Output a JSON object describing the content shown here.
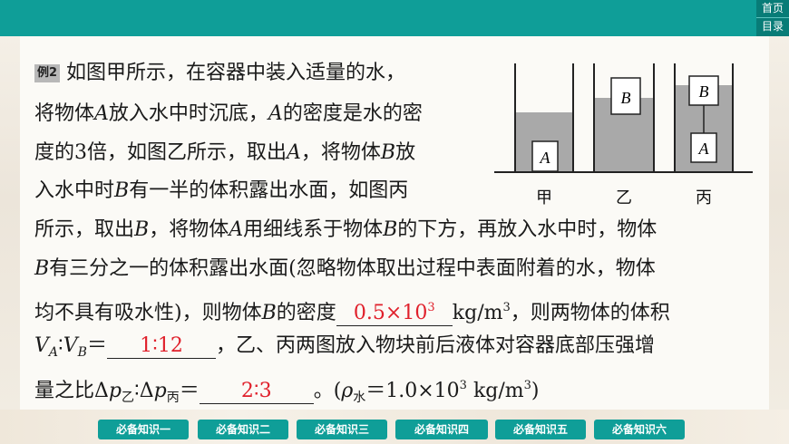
{
  "nav": {
    "home": "首页",
    "contents": "目录"
  },
  "example_tag": "例2",
  "problem": {
    "l1": "如图甲所示，在容器中装入适量的水，",
    "l2_a": "将物体",
    "l2_b": "A",
    "l2_c": "放入水中时沉底，",
    "l2_d": "A",
    "l2_e": "的密度是水的密",
    "l3_a": "度的3倍，如图乙所示，取出",
    "l3_b": "A",
    "l3_c": "，将物体",
    "l3_d": "B",
    "l3_e": "放",
    "l4_a": "入水中时",
    "l4_b": "B",
    "l4_c": "有一半的体积露出水面，如图丙",
    "l5_a": "所示，取出",
    "l5_b": "B",
    "l5_c": "，将物体",
    "l5_d": "A",
    "l5_e": "用细线系于物体",
    "l5_f": "B",
    "l5_g": "的下方，再放入水中时，物体",
    "l6_a": "B",
    "l6_b": "有三分之一的体积露出水面(忽略物体取出过程中表面附着的水，物体",
    "l7_a": "均不具有吸水性)，则物体",
    "l7_b": "B",
    "l7_c": "的密度",
    "l7_d": "kg/m",
    "l7_e": "3",
    "l7_f": "，则两物体的体积",
    "l8_a": "V",
    "l8_b": "A",
    "l8_c": "∶",
    "l8_d": "V",
    "l8_e": "B",
    "l8_f": "＝",
    "l8_g": "，乙、丙两图放入物块前后液体对容器底部压强增",
    "l9_a": "量之比Δ",
    "l9_b": "p",
    "l9_c": "乙",
    "l9_d": "∶Δ",
    "l9_e": "p",
    "l9_f": "丙",
    "l9_g": "＝",
    "l9_h": "。(",
    "l9_i": "ρ",
    "l9_j": "水",
    "l9_k": "＝1.0×10",
    "l9_l": "3",
    "l9_m": " kg/m",
    "l9_n": "3",
    "l9_o": ")"
  },
  "answers": {
    "density_base": "0.5×10",
    "density_exp": "3",
    "volume_ratio": "1∶12",
    "pressure_ratio": "2∶3"
  },
  "figure": {
    "label_jia": "甲",
    "label_yi": "乙",
    "label_bing": "丙",
    "block_a": "A",
    "block_b": "B",
    "colors": {
      "water": "#a9a9a9",
      "wall": "#222222"
    }
  },
  "tabs": [
    "必备知识一",
    "必备知识二",
    "必备知识三",
    "必备知识四",
    "必备知识五",
    "必备知识六"
  ]
}
